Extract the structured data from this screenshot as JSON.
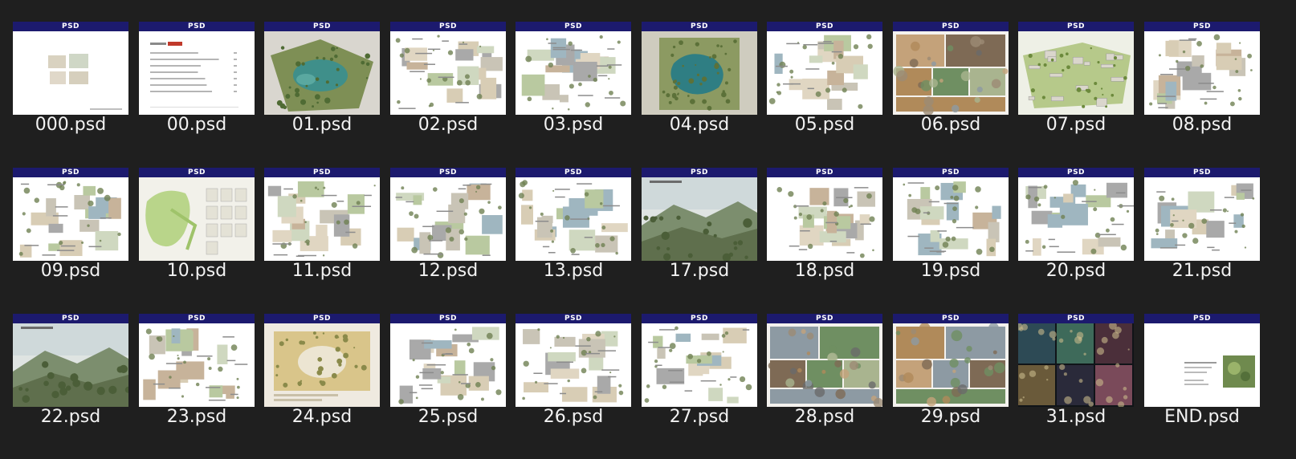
{
  "view": {
    "type": "file-explorer-large-icons",
    "background": "#1f1f1f",
    "badge_text": "PSD",
    "badge_color": "#1c1a6e",
    "label_color": "#f2f2f2"
  },
  "files": [
    {
      "name": "000.psd",
      "thumb": "cover-blank"
    },
    {
      "name": "00.psd",
      "thumb": "toc"
    },
    {
      "name": "01.psd",
      "thumb": "aerial-lake"
    },
    {
      "name": "02.psd",
      "thumb": "analysis-sheet"
    },
    {
      "name": "03.psd",
      "thumb": "analysis-sheet"
    },
    {
      "name": "04.psd",
      "thumb": "masterplan-lake"
    },
    {
      "name": "05.psd",
      "thumb": "analysis-sheet"
    },
    {
      "name": "06.psd",
      "thumb": "photo-collage"
    },
    {
      "name": "07.psd",
      "thumb": "aerial-green"
    },
    {
      "name": "08.psd",
      "thumb": "analysis-sheet"
    },
    {
      "name": "09.psd",
      "thumb": "analysis-sheet"
    },
    {
      "name": "10.psd",
      "thumb": "site-map"
    },
    {
      "name": "11.psd",
      "thumb": "analysis-sheet"
    },
    {
      "name": "12.psd",
      "thumb": "analysis-sheet"
    },
    {
      "name": "13.psd",
      "thumb": "analysis-sheet"
    },
    {
      "name": "17.psd",
      "thumb": "render-landscape"
    },
    {
      "name": "18.psd",
      "thumb": "analysis-sheet"
    },
    {
      "name": "19.psd",
      "thumb": "analysis-sheet"
    },
    {
      "name": "20.psd",
      "thumb": "analysis-sheet"
    },
    {
      "name": "21.psd",
      "thumb": "analysis-sheet"
    },
    {
      "name": "22.psd",
      "thumb": "render-landscape"
    },
    {
      "name": "23.psd",
      "thumb": "analysis-sheet"
    },
    {
      "name": "24.psd",
      "thumb": "masterplan-sand"
    },
    {
      "name": "25.psd",
      "thumb": "analysis-sheet"
    },
    {
      "name": "26.psd",
      "thumb": "analysis-sheet"
    },
    {
      "name": "27.psd",
      "thumb": "analysis-sheet"
    },
    {
      "name": "28.psd",
      "thumb": "photo-collage"
    },
    {
      "name": "29.psd",
      "thumb": "photo-collage"
    },
    {
      "name": "31.psd",
      "thumb": "dark-collage"
    },
    {
      "name": "END.psd",
      "thumb": "end-sheet"
    }
  ]
}
